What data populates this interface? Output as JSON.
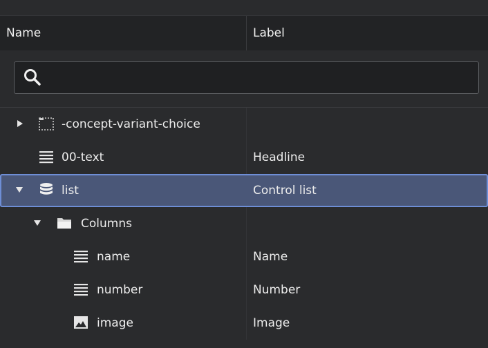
{
  "header": {
    "name_label": "Name",
    "label_label": "Label"
  },
  "search": {
    "value": "",
    "placeholder": ""
  },
  "rows": [
    {
      "name": "-concept-variant-choice",
      "label": "",
      "icon": "dotted-box-icon",
      "expand": "collapsed",
      "depth": 0
    },
    {
      "name": "00-text",
      "label": "Headline",
      "icon": "text-lines-icon",
      "expand": "none",
      "depth": 0
    },
    {
      "name": "list",
      "label": "Control list",
      "icon": "database-icon",
      "expand": "expanded",
      "depth": 0,
      "selected": true
    },
    {
      "name": "Columns",
      "label": "",
      "icon": "folder-icon",
      "expand": "expanded",
      "depth": 1
    },
    {
      "name": "name",
      "label": "Name",
      "icon": "text-lines-icon",
      "expand": "none",
      "depth": 2
    },
    {
      "name": "number",
      "label": "Number",
      "icon": "text-lines-icon",
      "expand": "none",
      "depth": 2
    },
    {
      "name": "image",
      "label": "Image",
      "icon": "image-icon",
      "expand": "none",
      "depth": 2
    }
  ],
  "colors": {
    "background": "#2a2b2d",
    "header": "#222325",
    "selection": "#4a5778",
    "selection_border": "#6e8ed6"
  }
}
